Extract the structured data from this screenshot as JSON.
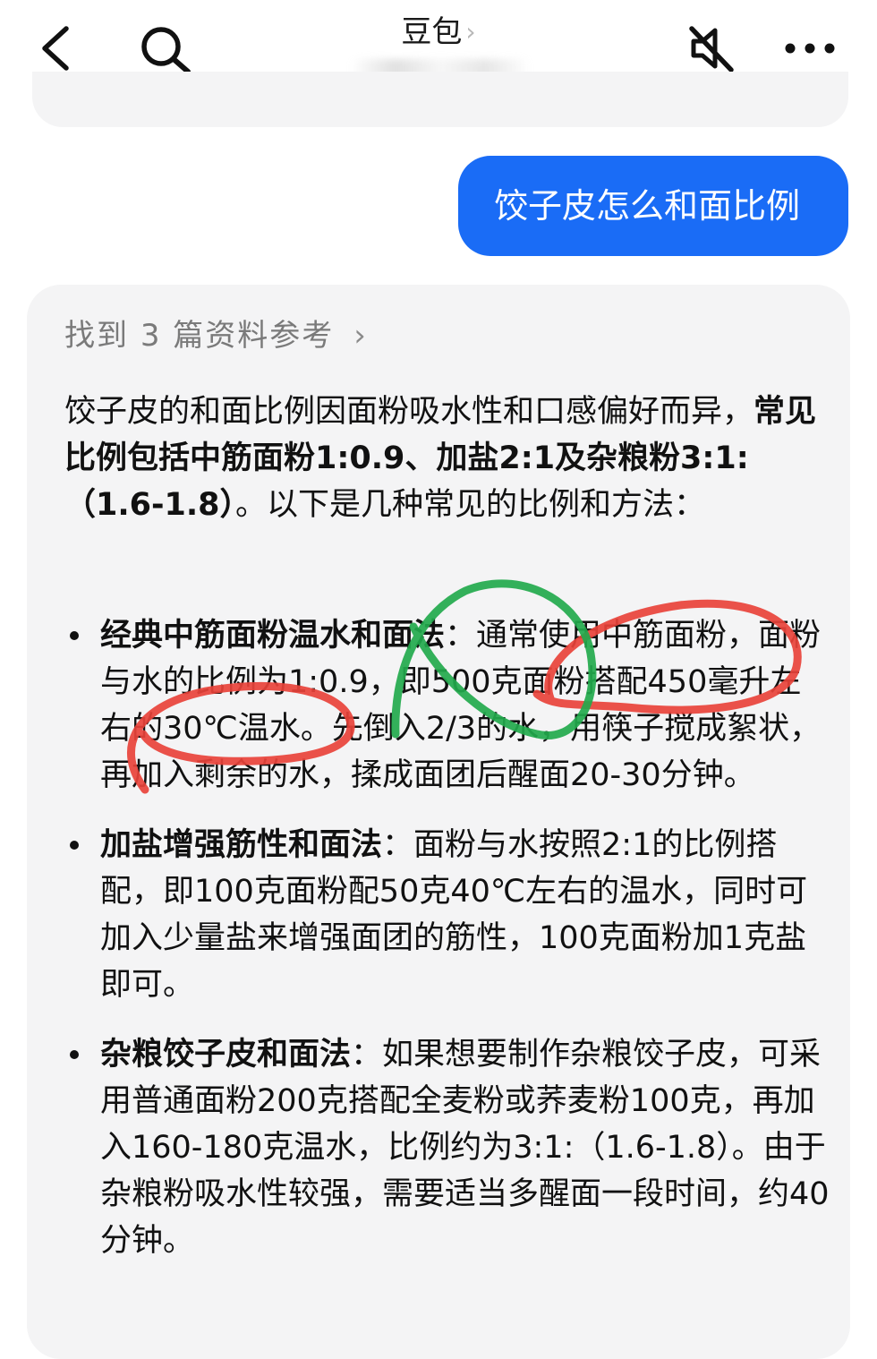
{
  "header": {
    "title": "豆包",
    "title_chevron": "›",
    "icons": [
      "back-arrow-icon",
      "search-icon",
      "mute-speaker-icon",
      "more-dots-icon"
    ]
  },
  "user_message": "饺子皮怎么和面比例",
  "answer": {
    "references_prefix": "找到",
    "references_count": "3",
    "references_suffix": "篇资料参考",
    "references_chevron": "›",
    "intro_lead": "饺子皮的和面比例因面粉吸水性和口感偏好而异，",
    "intro_bold": "常见比例包括中筋面粉1:0.9、加盐2:1及杂粮粉3:1:（1.6-1.8）",
    "intro_tail": "。以下是几种常见的比例和方法：",
    "methods": [
      {
        "title": "经典中筋面粉温水和面法",
        "body": "：通常使用中筋面粉，面粉与水的比例为1:0.9，即500克面粉搭配450毫升左右的30℃温水。先倒入2/3的水，用筷子搅成絮状，再加入剩余的水，揉成面团后醒面20-30分钟。"
      },
      {
        "title": "加盐增强筋性和面法",
        "body": "：面粉与水按照2:1的比例搭配，即100克面粉配50克40℃左右的温水，同时可加入少量盐来增强面团的筋性，100克面粉加1克盐即可。"
      },
      {
        "title": "杂粮饺子皮和面法",
        "body": "：如果想要制作杂粮饺子皮，可采用普通面粉200克搭配全麦粉或荞麦粉100克，再加入160-180克温水，比例约为3:1:（1.6-1.8）。由于杂粮粉吸水性较强，需要适当多醒面一段时间，约40分钟。"
      }
    ]
  },
  "colors": {
    "user_bubble": "#1a6cf6",
    "card_bg": "#f4f4f5",
    "annotation_red": "#e8423a",
    "annotation_green": "#22a94c"
  }
}
